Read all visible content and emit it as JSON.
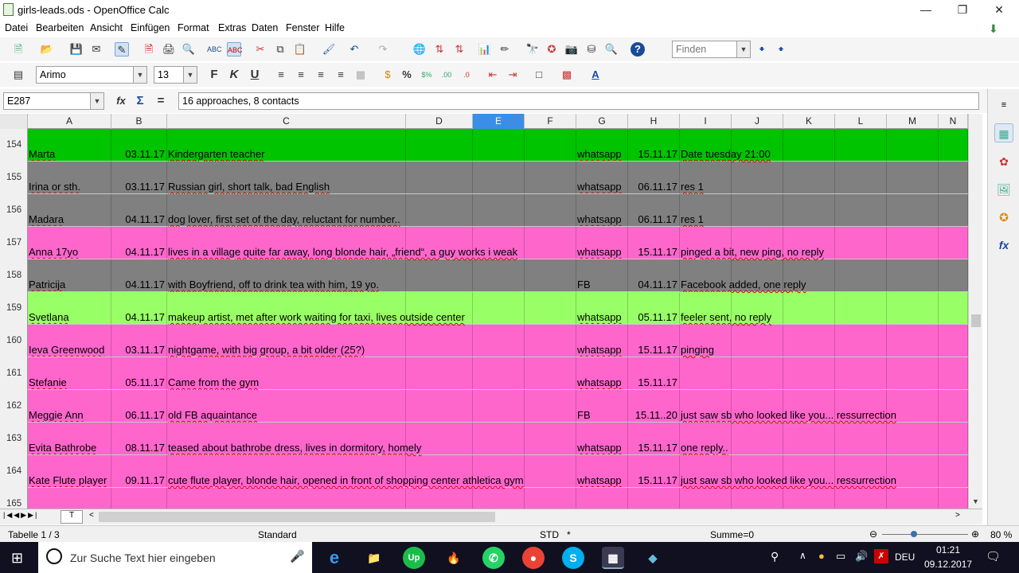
{
  "window": {
    "title": "girls-leads.ods - OpenOffice Calc"
  },
  "menu": [
    "Datei",
    "Bearbeiten",
    "Ansicht",
    "Einfügen",
    "Format",
    "Extras",
    "Daten",
    "Fenster",
    "Hilfe"
  ],
  "toolbar": {
    "find_placeholder": "Finden"
  },
  "format": {
    "font": "Arimo",
    "size": "13"
  },
  "formula": {
    "cell_ref": "E287",
    "content": "16 approaches, 8 contacts"
  },
  "columns": [
    "A",
    "B",
    "C",
    "D",
    "E",
    "F",
    "G",
    "H",
    "I",
    "J",
    "K",
    "L",
    "M",
    "N"
  ],
  "rows": [
    {
      "num": "154",
      "a": "Marta",
      "b": "03.11.17",
      "c": "Kindergarten teacher",
      "g": "whatsapp",
      "h": "15.11.17",
      "i": "Date tuesday 21:00",
      "color": "#00c400"
    },
    {
      "num": "155",
      "a": "Irina or sth.",
      "b": "03.11.17",
      "c": "Russian girl, short talk, bad English",
      "g": "whatsapp",
      "h": "06.11.17",
      "i": "res 1",
      "color": "#808080"
    },
    {
      "num": "156",
      "a": "Madara",
      "b": "04.11.17",
      "c": "dog lover, first set of the day, reluctant for number..",
      "g": "whatsapp",
      "h": "06.11.17",
      "i": "res 1",
      "color": "#808080"
    },
    {
      "num": "157",
      "a": "Anna 17yo",
      "b": "04.11.17",
      "c": "lives in a village quite far away, long blonde hair, „friend“, a guy works i weak",
      "g": "whatsapp",
      "h": "15.11.17",
      "i": "pinged a bit, new ping, no reply",
      "color": "#ff66cc"
    },
    {
      "num": "158",
      "a": "Patricija",
      "b": "04.11.17",
      "c": "with Boyfriend, off to drink tea with him, 19 yo.",
      "g": "FB",
      "h": "04.11.17",
      "i": "Facebook added, one reply",
      "color": "#808080"
    },
    {
      "num": "159",
      "a": "Svetlana",
      "b": "04.11.17",
      "c": "makeup artist, met after work waiting for taxi, lives outside center",
      "g": "whatsapp",
      "h": "05.11.17",
      "i": "feeler sent, no reply",
      "color": "#99ff66"
    },
    {
      "num": "160",
      "a": "Ieva Greenwood",
      "b": "03.11.17",
      "c": "nightgame, with big group, a bit older (25?)",
      "g": "whatsapp",
      "h": "15.11.17",
      "i": "pinging",
      "color": "#ff66cc"
    },
    {
      "num": "161",
      "a": "Stefanie",
      "b": "05.11.17",
      "c": "Came from the gym",
      "g": "whatsapp",
      "h": "15.11.17",
      "i": "",
      "color": "#ff66cc"
    },
    {
      "num": "162",
      "a": "Meggie Ann",
      "b": "06.11.17",
      "c": "old FB aquaintance",
      "g": "FB",
      "h": "15.11..20",
      "i": "just saw sb who looked like you... ressurrection",
      "color": "#ff66cc"
    },
    {
      "num": "163",
      "a": "Evita Bathrobe",
      "b": "08.11.17",
      "c": "teased about bathrobe dress, lives in dormitory, homely",
      "g": "whatsapp",
      "h": "15.11.17",
      "i": "one reply..",
      "color": "#ff66cc"
    },
    {
      "num": "164",
      "a": "Kate Flute player",
      "b": "09.11.17",
      "c": "cute flute player, blonde hair, opened in front of shopping center athletica gym",
      "g": "whatsapp",
      "h": "15.11.17",
      "i": "just saw sb who looked like you... ressurrection",
      "color": "#ff66cc"
    },
    {
      "num": "165",
      "a": "",
      "b": "",
      "c": "",
      "g": "",
      "h": "",
      "i": "",
      "color": "#ff66cc"
    }
  ],
  "status": {
    "sheet": "Tabelle 1 / 3",
    "style": "Standard",
    "mode": "STD",
    "modified": "*",
    "sum": "Summe=0",
    "zoom": "80 %"
  },
  "taskbar": {
    "search_placeholder": "Zur Suche Text hier eingeben",
    "lang": "DEU",
    "time": "01:21",
    "date": "09.12.2017"
  }
}
